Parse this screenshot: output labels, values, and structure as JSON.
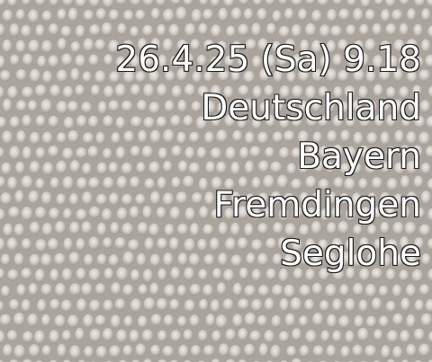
{
  "photo": {
    "subject": "knobbly grey-beige textured surface",
    "colors": {
      "background": "#b9b4ae",
      "knob_light": "#e4e1dc",
      "knob_mid": "#c9c4bd",
      "knob_shadow": "#8e8881",
      "stamp_text": "#ffffff",
      "stamp_outline": "#1a1a1a"
    }
  },
  "stamp": {
    "datetime": "26.4.25 (Sa) 9.18",
    "country": "Deutschland",
    "state": "Bayern",
    "town": "Fremdingen",
    "locality": "Seglohe"
  }
}
